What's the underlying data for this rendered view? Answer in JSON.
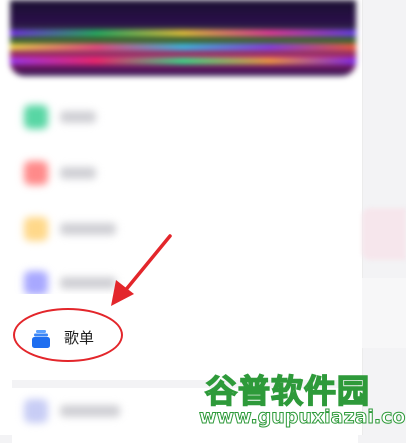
{
  "menu": {
    "playlist_label": "歌单",
    "playlist_icon": "playlist-stack-icon"
  },
  "annotation": {
    "color": "#e3262b"
  },
  "watermark": {
    "title": "谷普软件园",
    "url": "www.gupuxiazai.com",
    "color": "#2e9a3a"
  }
}
